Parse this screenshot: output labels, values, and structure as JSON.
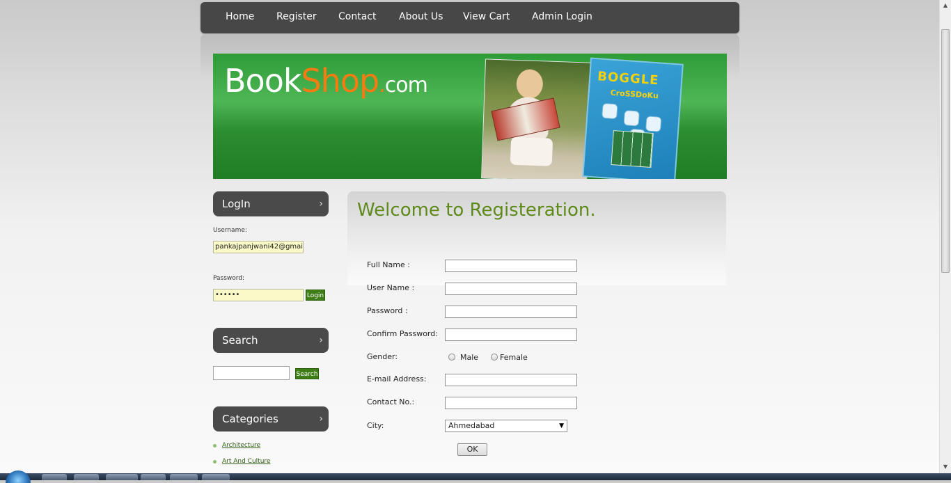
{
  "nav": {
    "items": [
      "Home",
      "Register",
      "Contact",
      "About Us",
      "View Cart",
      "Admin Login"
    ]
  },
  "banner": {
    "logo_part1": "Book",
    "logo_part2": "Shop",
    "logo_part3": ".",
    "logo_part4": "com",
    "game_title": "BOGGLE",
    "game_subtitle": "CroSSDoKu"
  },
  "sidebar": {
    "login": {
      "header": "LogIn",
      "chevron": "›",
      "username_label": "Username:",
      "username_value": "pankajpanjwani42@gmai",
      "password_label": "Password:",
      "password_value": "••••••",
      "login_button": "Login"
    },
    "search": {
      "header": "Search",
      "chevron": "›",
      "input_value": "",
      "button": "Search"
    },
    "categories": {
      "header": "Categories",
      "chevron": "›",
      "items": [
        "Architecture",
        "Art And Culture"
      ]
    }
  },
  "form": {
    "title": "Welcome to Registeration.",
    "full_name_label": "Full Name :",
    "user_name_label": "User Name :",
    "password_label": "Password :",
    "confirm_password_label": "Confirm Password:",
    "gender_label": "Gender:",
    "gender_male": "Male",
    "gender_female": "Female",
    "email_label": "E-mail Address:",
    "contact_label": "Contact No.:",
    "city_label": "City:",
    "city_value": "Ahmedabad",
    "city_arrow": "▼",
    "ok_button": "OK"
  },
  "colors": {
    "nav_bg": "#474747",
    "banner_green": "#2c8d31",
    "logo_accent": "#f57c12",
    "title_green": "#5e8a1c",
    "button_green": "#3f7d17"
  },
  "icons": {
    "scroll_up": "▲",
    "scroll_down": "▼"
  }
}
